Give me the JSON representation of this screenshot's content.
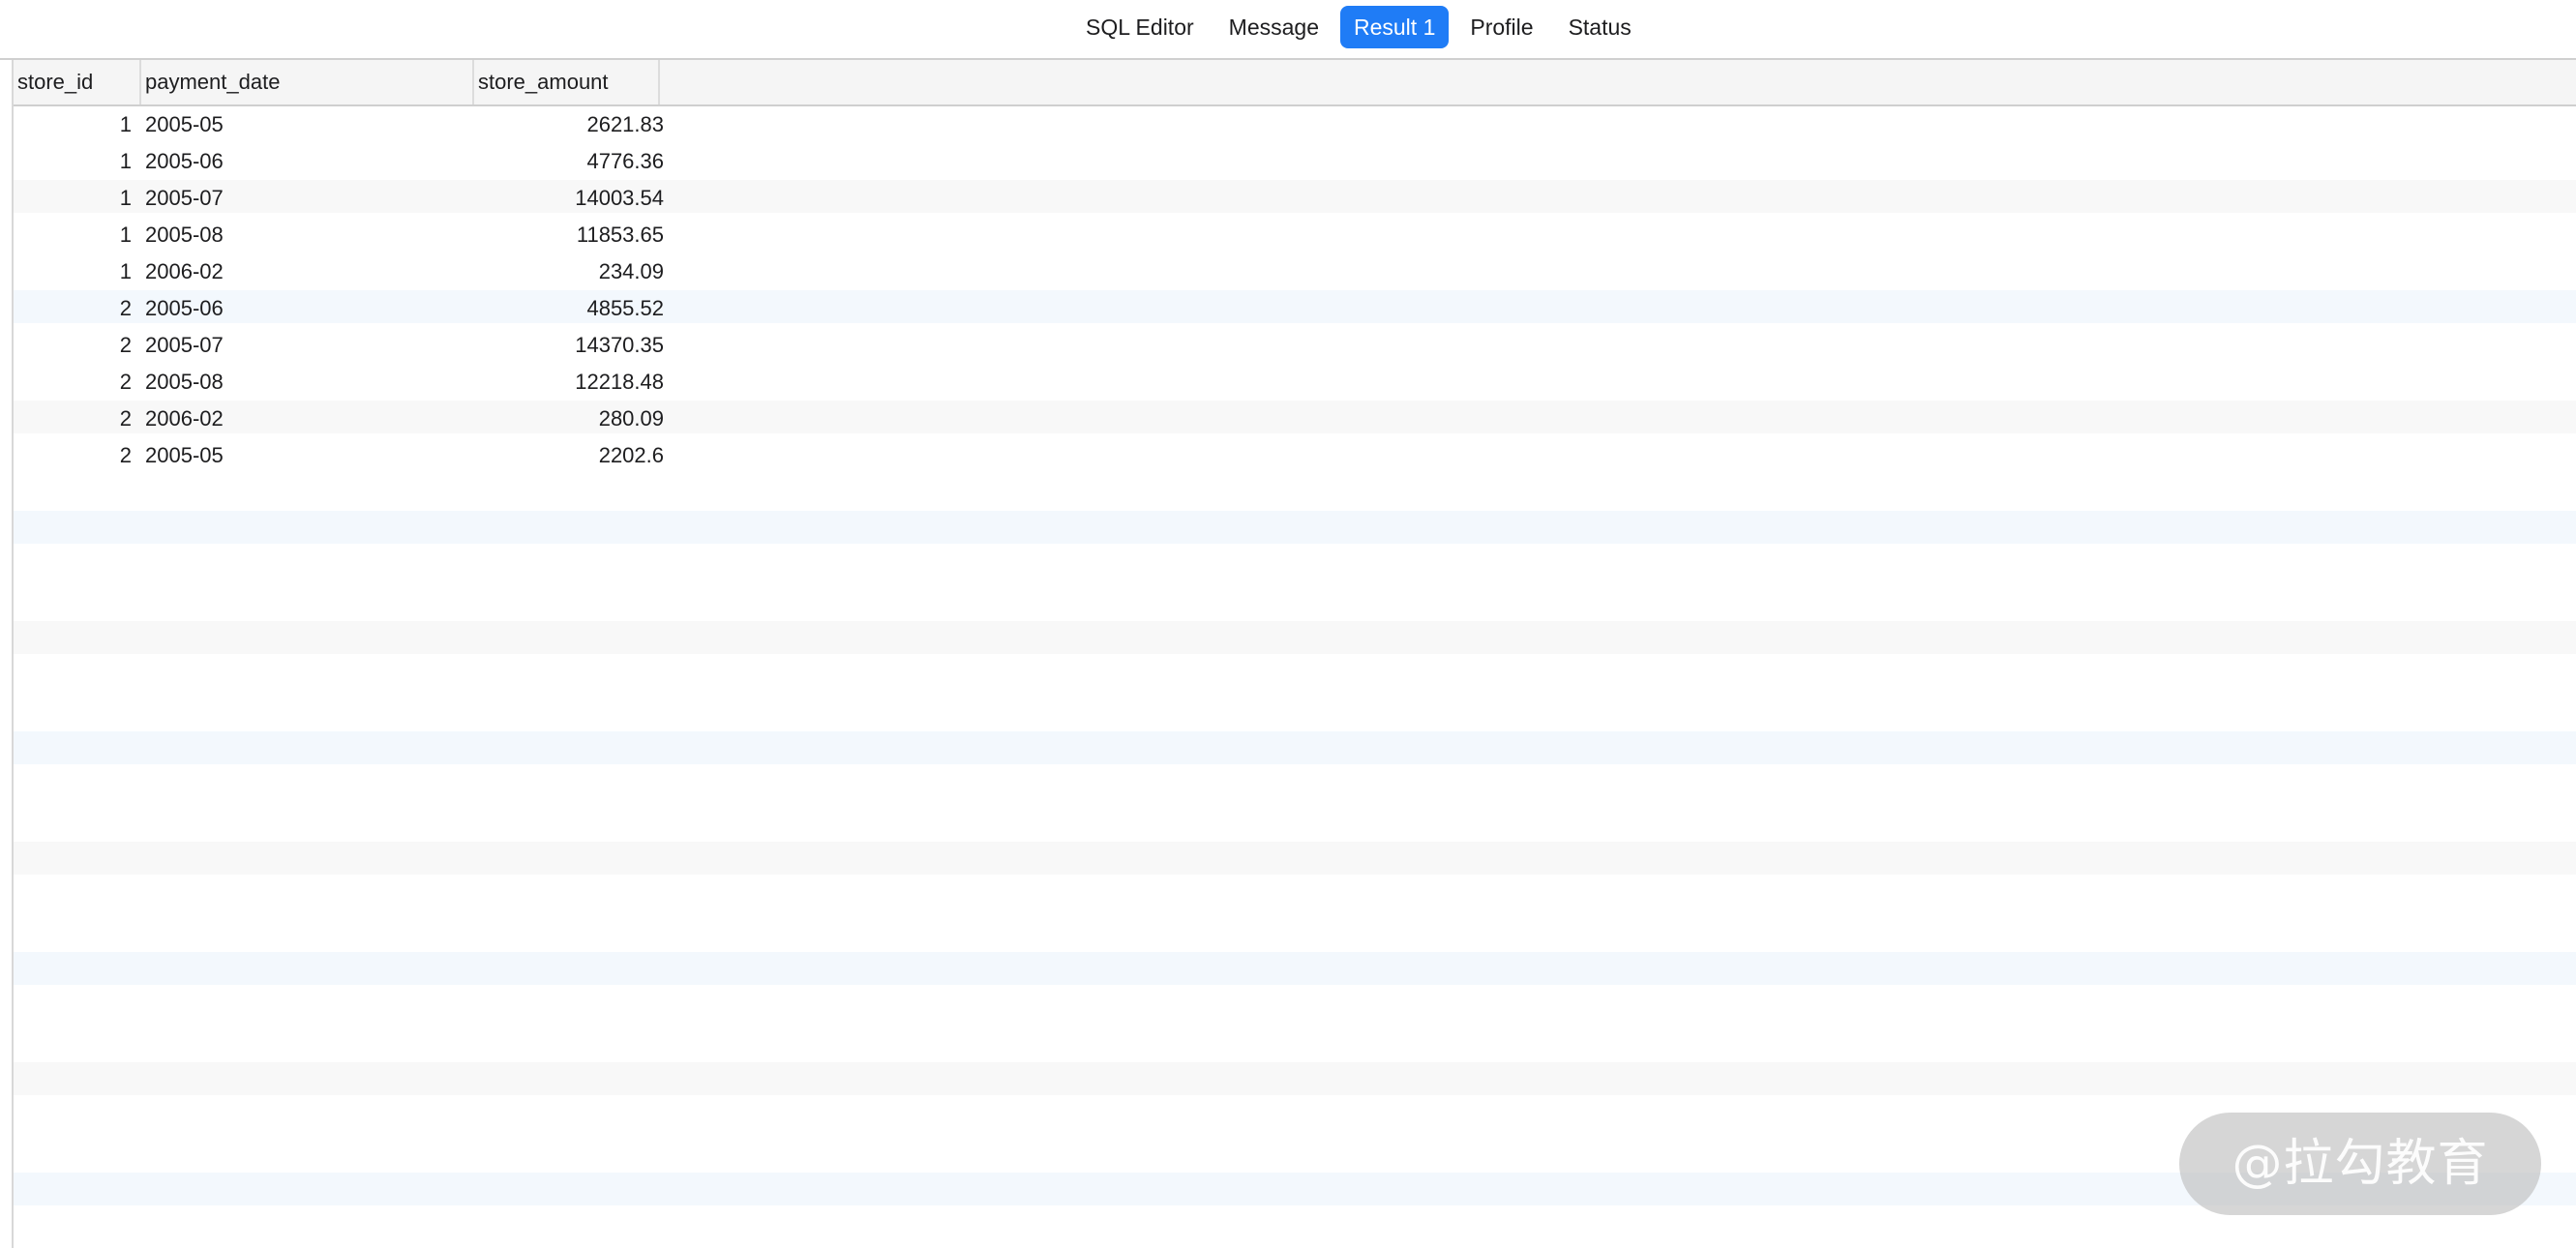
{
  "tabs": [
    "SQL Editor",
    "Message",
    "Result 1",
    "Profile",
    "Status"
  ],
  "active_tab": "Result 1",
  "columns": [
    "store_id",
    "payment_date",
    "store_amount"
  ],
  "rows": [
    [
      "1",
      "2005-05",
      "2621.83"
    ],
    [
      "1",
      "2005-06",
      "4776.36"
    ],
    [
      "1",
      "2005-07",
      "14003.54"
    ],
    [
      "1",
      "2005-08",
      "11853.65"
    ],
    [
      "1",
      "2006-02",
      "234.09"
    ],
    [
      "2",
      "2005-06",
      "4855.52"
    ],
    [
      "2",
      "2005-07",
      "14370.35"
    ],
    [
      "2",
      "2005-08",
      "12218.48"
    ],
    [
      "2",
      "2006-02",
      "280.09"
    ],
    [
      "2",
      "2005-05",
      "2202.6"
    ]
  ],
  "watermark": "@拉勾教育",
  "colors": {
    "active_tab": "#1f7cf6",
    "stripe_blue": "#f3f8fd",
    "stripe_gray": "#f8f8f8"
  }
}
